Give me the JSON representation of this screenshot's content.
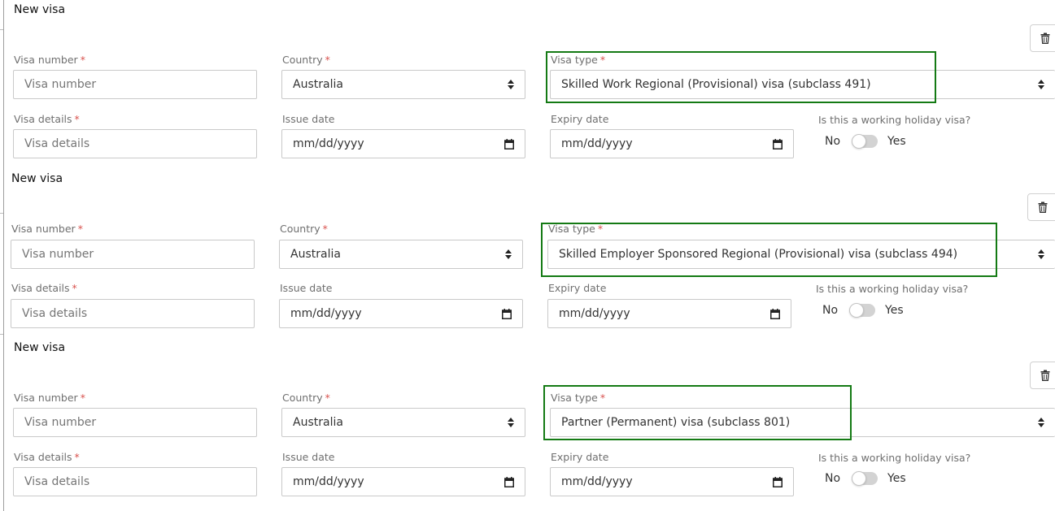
{
  "visas": [
    {
      "title": "New visa",
      "visa_number": {
        "label": "Visa number",
        "placeholder": "Visa number"
      },
      "country": {
        "label": "Country",
        "value": "Australia"
      },
      "visa_type": {
        "label": "Visa type",
        "value": "Skilled Work Regional (Provisional) visa (subclass 491)"
      },
      "visa_details": {
        "label": "Visa details",
        "placeholder": "Visa details"
      },
      "issue_date": {
        "label": "Issue date",
        "placeholder": "mm/dd/yyyy"
      },
      "expiry_date": {
        "label": "Expiry date",
        "placeholder": "mm/dd/yyyy"
      },
      "working_holiday": {
        "label": "Is this a working holiday visa?",
        "no": "No",
        "yes": "Yes",
        "value": false
      },
      "required_mark": "*"
    },
    {
      "title": "New visa",
      "visa_number": {
        "label": "Visa number",
        "placeholder": "Visa number"
      },
      "country": {
        "label": "Country",
        "value": "Australia"
      },
      "visa_type": {
        "label": "Visa type",
        "value": "Skilled Employer Sponsored Regional (Provisional) visa (subclass 494)"
      },
      "visa_details": {
        "label": "Visa details",
        "placeholder": "Visa details"
      },
      "issue_date": {
        "label": "Issue date",
        "placeholder": "mm/dd/yyyy"
      },
      "expiry_date": {
        "label": "Expiry date",
        "placeholder": "mm/dd/yyyy"
      },
      "working_holiday": {
        "label": "Is this a working holiday visa?",
        "no": "No",
        "yes": "Yes",
        "value": false
      },
      "required_mark": "*"
    },
    {
      "title": "New visa",
      "visa_number": {
        "label": "Visa number",
        "placeholder": "Visa number"
      },
      "country": {
        "label": "Country",
        "value": "Australia"
      },
      "visa_type": {
        "label": "Visa type",
        "value": "Partner (Permanent) visa (subclass 801)"
      },
      "visa_details": {
        "label": "Visa details",
        "placeholder": "Visa details"
      },
      "issue_date": {
        "label": "Issue date",
        "placeholder": "mm/dd/yyyy"
      },
      "expiry_date": {
        "label": "Expiry date",
        "placeholder": "mm/dd/yyyy"
      },
      "working_holiday": {
        "label": "Is this a working holiday visa?",
        "no": "No",
        "yes": "Yes",
        "value": false
      },
      "required_mark": "*"
    }
  ],
  "icons": {
    "delete": "trash-icon",
    "calendar": "calendar-icon",
    "select": "select-arrows-icon"
  },
  "colors": {
    "highlight": "#147a14",
    "required": "#d9534f",
    "border": "#c9c9c9"
  }
}
